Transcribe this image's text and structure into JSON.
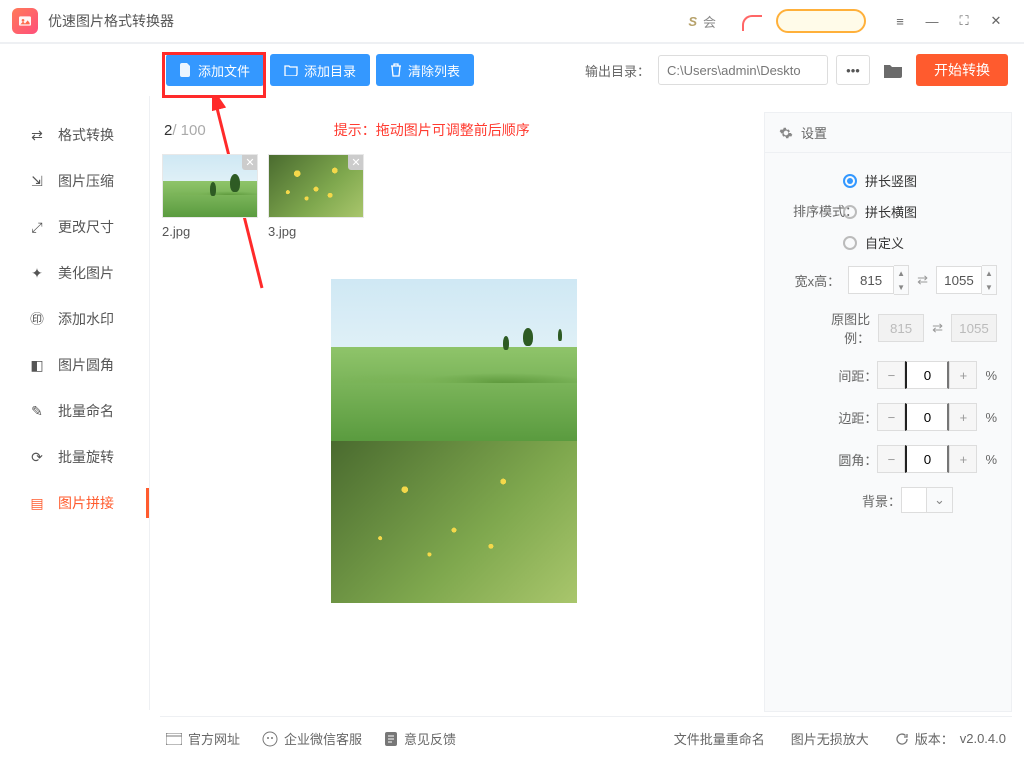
{
  "app": {
    "title": "优速图片格式转换器",
    "mid_label": "会"
  },
  "window": {
    "menu": "≡",
    "min": "—",
    "max": "⛶",
    "close": "✕"
  },
  "toolbar": {
    "add_file": "添加文件",
    "add_folder": "添加目录",
    "clear": "清除列表",
    "output_label": "输出目录：",
    "output_path": "C:\\Users\\admin\\Deskto",
    "dots": "•••",
    "start": "开始转换"
  },
  "sidebar": {
    "items": [
      {
        "label": "格式转换"
      },
      {
        "label": "图片压缩"
      },
      {
        "label": "更改尺寸"
      },
      {
        "label": "美化图片"
      },
      {
        "label": "添加水印"
      },
      {
        "label": "图片圆角"
      },
      {
        "label": "批量命名"
      },
      {
        "label": "批量旋转"
      },
      {
        "label": "图片拼接"
      }
    ],
    "active_index": 8
  },
  "main": {
    "current": "2",
    "total": " / 100",
    "hint": "提示：拖动图片可调整前后顺序",
    "thumbs": [
      {
        "name": "2.jpg",
        "kind": "land"
      },
      {
        "name": "3.jpg",
        "kind": "flower"
      }
    ]
  },
  "panel": {
    "title": "设置",
    "layout_label": "排序模式：",
    "layout_options": [
      "拼长竖图",
      "拼长横图",
      "自定义"
    ],
    "layout_selected": 0,
    "wh_label": "宽x高：",
    "width": "815",
    "height": "1055",
    "ratio_label": "原图比例：",
    "ratio_w": "815",
    "ratio_h": "1055",
    "gap_label": "间距：",
    "gap_val": "0",
    "margin_label": "边距：",
    "margin_val": "0",
    "radius_label": "圆角：",
    "radius_val": "0",
    "bg_label": "背景：",
    "pct": "%"
  },
  "footer": {
    "site": "官方网址",
    "wechat": "企业微信客服",
    "feedback": "意见反馈",
    "rename": "文件批量重命名",
    "lossless": "图片无损放大",
    "version_label": "版本：",
    "version": "v2.0.4.0"
  }
}
